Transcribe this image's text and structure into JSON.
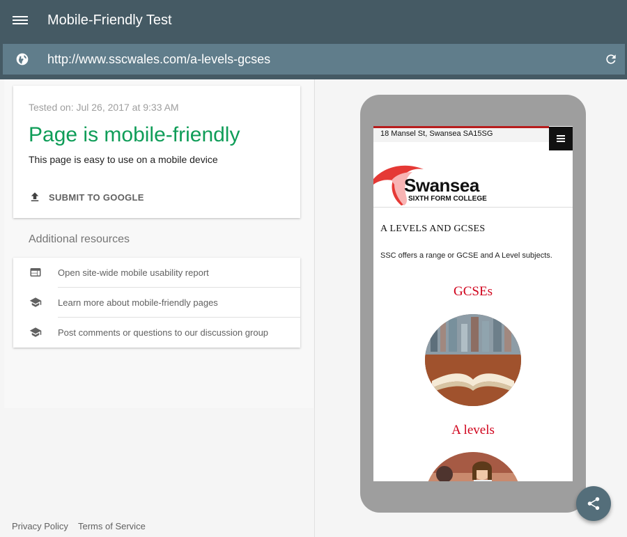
{
  "header": {
    "title": "Mobile-Friendly Test",
    "menu_icon": "hamburger-menu-icon"
  },
  "urlbar": {
    "url": "http://www.sscwales.com/a-levels-gcses",
    "left_icon": "globe-icon",
    "right_icon": "reload-icon"
  },
  "result": {
    "tested_on": "Tested on: Jul 26, 2017 at 9:33 AM",
    "title": "Page is mobile-friendly",
    "description": "This page is easy to use on a mobile device",
    "submit_label": "SUBMIT TO GOOGLE",
    "title_color": "#0f9d58"
  },
  "resources": {
    "title": "Additional resources",
    "items": [
      {
        "label": "Open site-wide mobile usability report",
        "icon": "web-window-icon"
      },
      {
        "label": "Learn more about mobile-friendly pages",
        "icon": "graduation-cap-icon"
      },
      {
        "label": "Post comments or questions to our discussion group",
        "icon": "graduation-cap-icon"
      }
    ]
  },
  "footer": {
    "privacy": "Privacy Policy",
    "terms": "Terms of Service"
  },
  "preview": {
    "address": "18 Mansel St, Swansea SA15SG",
    "logo_name": "Swansea",
    "logo_sub": "SIXTH FORM COLLEGE",
    "heading": "A LEVELS AND GCSES",
    "intro": "SSC offers a range or GCSE and A Level subjects.",
    "section1": "GCSEs",
    "section2": "A levels",
    "accent_color": "#d0021b"
  },
  "colors": {
    "header_bg": "#455a64",
    "urlbar_bg": "#607d8b",
    "fab_bg": "#546e7a"
  }
}
